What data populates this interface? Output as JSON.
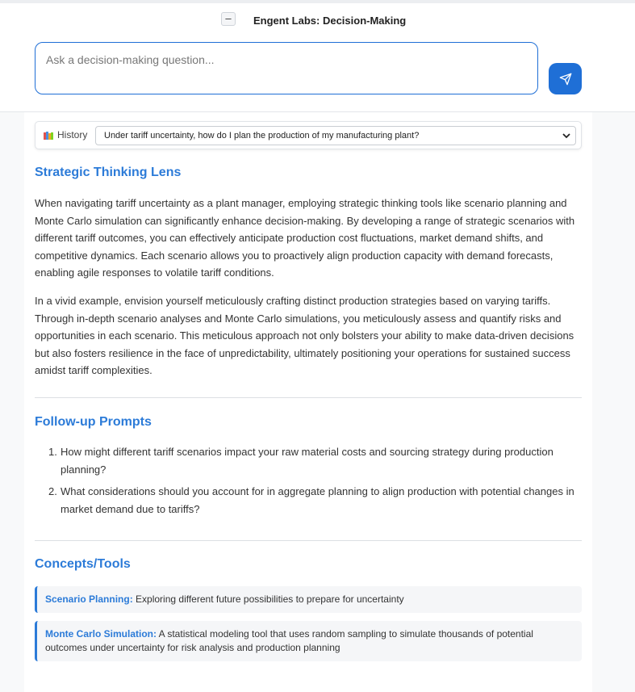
{
  "header": {
    "collapse_label": "–",
    "title": "Engent Labs: Decision-Making",
    "question_placeholder": "Ask a decision-making question...",
    "question_value": ""
  },
  "history": {
    "label": "History",
    "selected": "Under tariff uncertainty, how do I plan the production of my manufacturing plant?"
  },
  "lens": {
    "heading": "Strategic Thinking Lens",
    "paragraphs": [
      "When navigating tariff uncertainty as a plant manager, employing strategic thinking tools like scenario planning and Monte Carlo simulation can significantly enhance decision-making. By developing a range of strategic scenarios with different tariff outcomes, you can effectively anticipate production cost fluctuations, market demand shifts, and competitive dynamics. Each scenario allows you to proactively align production capacity with demand forecasts, enabling agile responses to volatile tariff conditions.",
      "In a vivid example, envision yourself meticulously crafting distinct production strategies based on varying tariffs. Through in-depth scenario analyses and Monte Carlo simulations, you meticulously assess and quantify risks and opportunities in each scenario. This meticulous approach not only bolsters your ability to make data-driven decisions but also fosters resilience in the face of unpredictability, ultimately positioning your operations for sustained success amidst tariff complexities."
    ]
  },
  "followup": {
    "heading": "Follow-up Prompts",
    "items": [
      {
        "num": "1.",
        "text": "How might different tariff scenarios impact your raw material costs and sourcing strategy during production planning?"
      },
      {
        "num": "2.",
        "text": "What considerations should you account for in aggregate planning to align production with potential changes in market demand due to tariffs?"
      }
    ]
  },
  "concepts": {
    "heading": "Concepts/Tools",
    "items": [
      {
        "name": "Scenario Planning:",
        "desc": "Exploring different future possibilities to prepare for uncertainty"
      },
      {
        "name": "Monte Carlo Simulation:",
        "desc": "A statistical modeling tool that uses random sampling to simulate thousands of potential outcomes under uncertainty for risk analysis and production planning"
      }
    ]
  },
  "colors": {
    "accent": "#2c7bd8",
    "send_button": "#1f6fd6"
  },
  "icons": {
    "send": "send-paper-plane-icon",
    "history": "books-icon",
    "dropdown": "chevron-down-icon"
  }
}
